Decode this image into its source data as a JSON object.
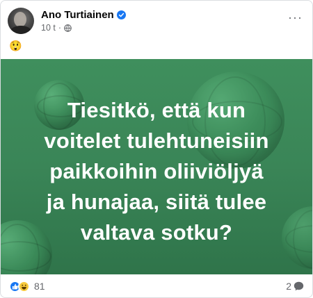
{
  "post": {
    "author": "Ano Turtiainen",
    "time": "10 t",
    "separator": "·",
    "body_emoji": "😲",
    "image_lines": [
      "Tiesitkö, että kun",
      "voitelet tulehtuneisiin",
      "paikkoihin oliiviöljyä",
      "ja hunajaa, siitä tulee",
      "valtava sotku?"
    ],
    "reaction_count": "81",
    "comment_count": "2",
    "more_label": "···"
  },
  "colors": {
    "image_bg": "#3a8557",
    "like": "#1877f2",
    "haha": "#f7c93c",
    "verified": "#1877f2"
  },
  "icons": [
    "verified-badge-icon",
    "globe-icon",
    "like-reaction-icon",
    "haha-reaction-icon",
    "comment-icon",
    "more-options-icon"
  ]
}
